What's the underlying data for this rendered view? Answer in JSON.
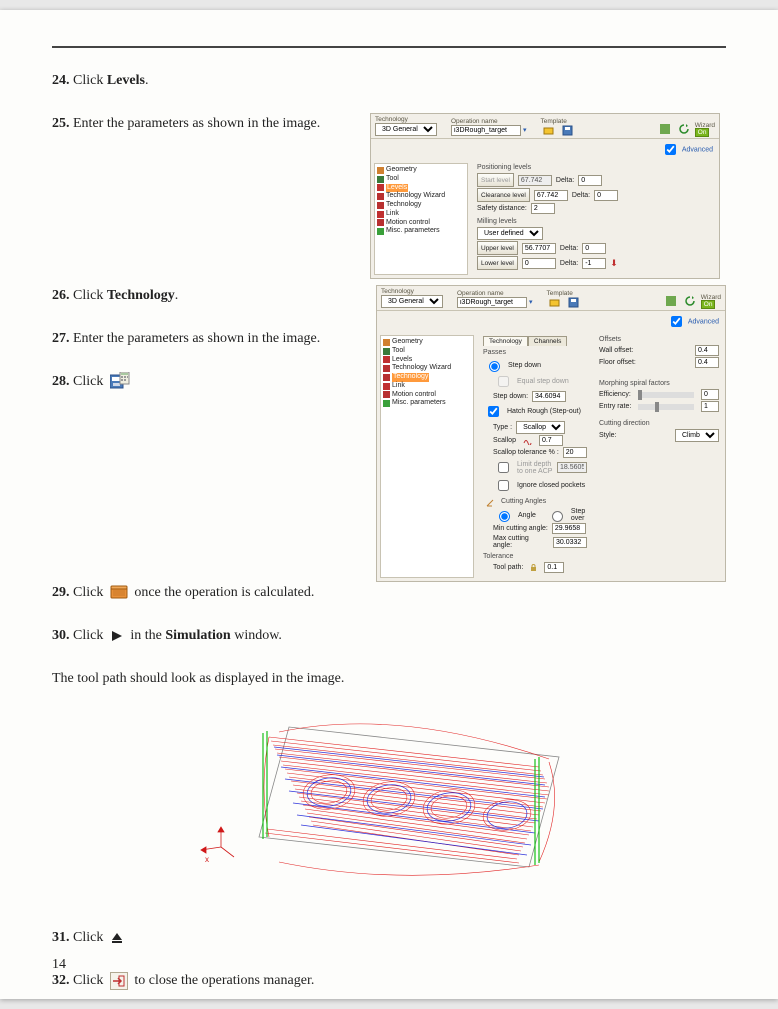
{
  "steps": {
    "s24": {
      "num": "24.",
      "pre": "Click ",
      "bold": "Levels",
      "post": "."
    },
    "s25": {
      "num": "25.",
      "text": "Enter the parameters as shown in the image."
    },
    "s26": {
      "num": "26.",
      "pre": "Click ",
      "bold": "Technology",
      "post": "."
    },
    "s27": {
      "num": "27.",
      "text": "Enter the parameters as shown in the image."
    },
    "s28": {
      "num": "28.",
      "text": "Click "
    },
    "s29": {
      "num": "29.",
      "pre": "Click ",
      "post": " once the operation is calculated."
    },
    "s30": {
      "num": "30.",
      "pre": "Click ",
      "mid": " in the ",
      "bold": "Simulation",
      "post": " window."
    },
    "s30b": "The tool path should look as displayed in the image.",
    "s31": {
      "num": "31.",
      "text": "Click "
    },
    "s32": {
      "num": "32.",
      "pre": "Click ",
      "post": " to close the operations manager."
    }
  },
  "shot1": {
    "header": {
      "tech": "Technology",
      "techval": "3D General",
      "opname": "Operation name",
      "opval": "i3DRough_target",
      "tmpl": "Template",
      "wiz": "Wizard",
      "on": "On",
      "adv": "Advanced"
    },
    "tree": [
      "Geometry",
      "Tool",
      "Levels",
      "Technology Wizard",
      "Technology",
      "Link",
      "Motion control",
      "Misc. parameters"
    ],
    "tree_hl": "Levels",
    "pos": {
      "title": "Positioning levels",
      "start": "Start level",
      "startv": "67.742",
      "clear": "Clearance level",
      "clearv": "67.742",
      "delta": "Delta:",
      "d1": "0",
      "d2": "0",
      "safe": "Safety distance:",
      "safev": "2"
    },
    "mill": {
      "title": "Milling levels",
      "ud": "User defined",
      "upper": "Upper level",
      "upperv": "56.7707",
      "lower": "Lower level",
      "lowerv": "0",
      "d1": "0",
      "d2": "-1"
    }
  },
  "shot2": {
    "header": {
      "tech": "Technology",
      "techval": "3D General",
      "opname": "Operation name",
      "opval": "i3DRough_target",
      "tmpl": "Template",
      "wiz": "Wizard",
      "on": "On",
      "adv": "Advanced"
    },
    "tree": [
      "Geometry",
      "Tool",
      "Levels",
      "Technology Wizard",
      "Technology",
      "Link",
      "Motion control",
      "Misc. parameters"
    ],
    "tree_hl": "Technology",
    "tabs": [
      "Technology",
      "Channels"
    ],
    "passes": {
      "title": "Passes",
      "sd": "Step down",
      "esd": "Equal step down",
      "sdlbl": "Step down:",
      "sdval": "34.6094",
      "hr": "Hatch Rough (Step-out)",
      "type": "Type :",
      "typev": "Scallop",
      "scallop": "Scallop",
      "scallopv": "0.7",
      "tol": "Scallop tolerance % :",
      "tolv": "20",
      "limit": "Limit depth to one ACP",
      "limitv": "18.5605",
      "ign": "Ignore closed pockets"
    },
    "offsets": {
      "title": "Offsets",
      "wall": "Wall offset:",
      "wallv": "0.4",
      "floor": "Floor offset:",
      "floorv": "0.4"
    },
    "morph": {
      "title": "Morphing spiral factors",
      "eff": "Efficiency:",
      "effv": "0",
      "entry": "Entry rate:",
      "entryv": "1"
    },
    "cut": {
      "title": "Cutting direction",
      "style": "Style:",
      "stylev": "Climb"
    },
    "angles": {
      "title": "Cutting Angles",
      "angle": "Angle",
      "step": "Step over",
      "min": "Min cutting angle:",
      "minv": "29.9658",
      "max": "Max cutting angle:",
      "maxv": "30.0332"
    },
    "tolr": {
      "title": "Tolerance",
      "tp": "Tool path:",
      "tpv": "0.1"
    }
  },
  "page": "14"
}
